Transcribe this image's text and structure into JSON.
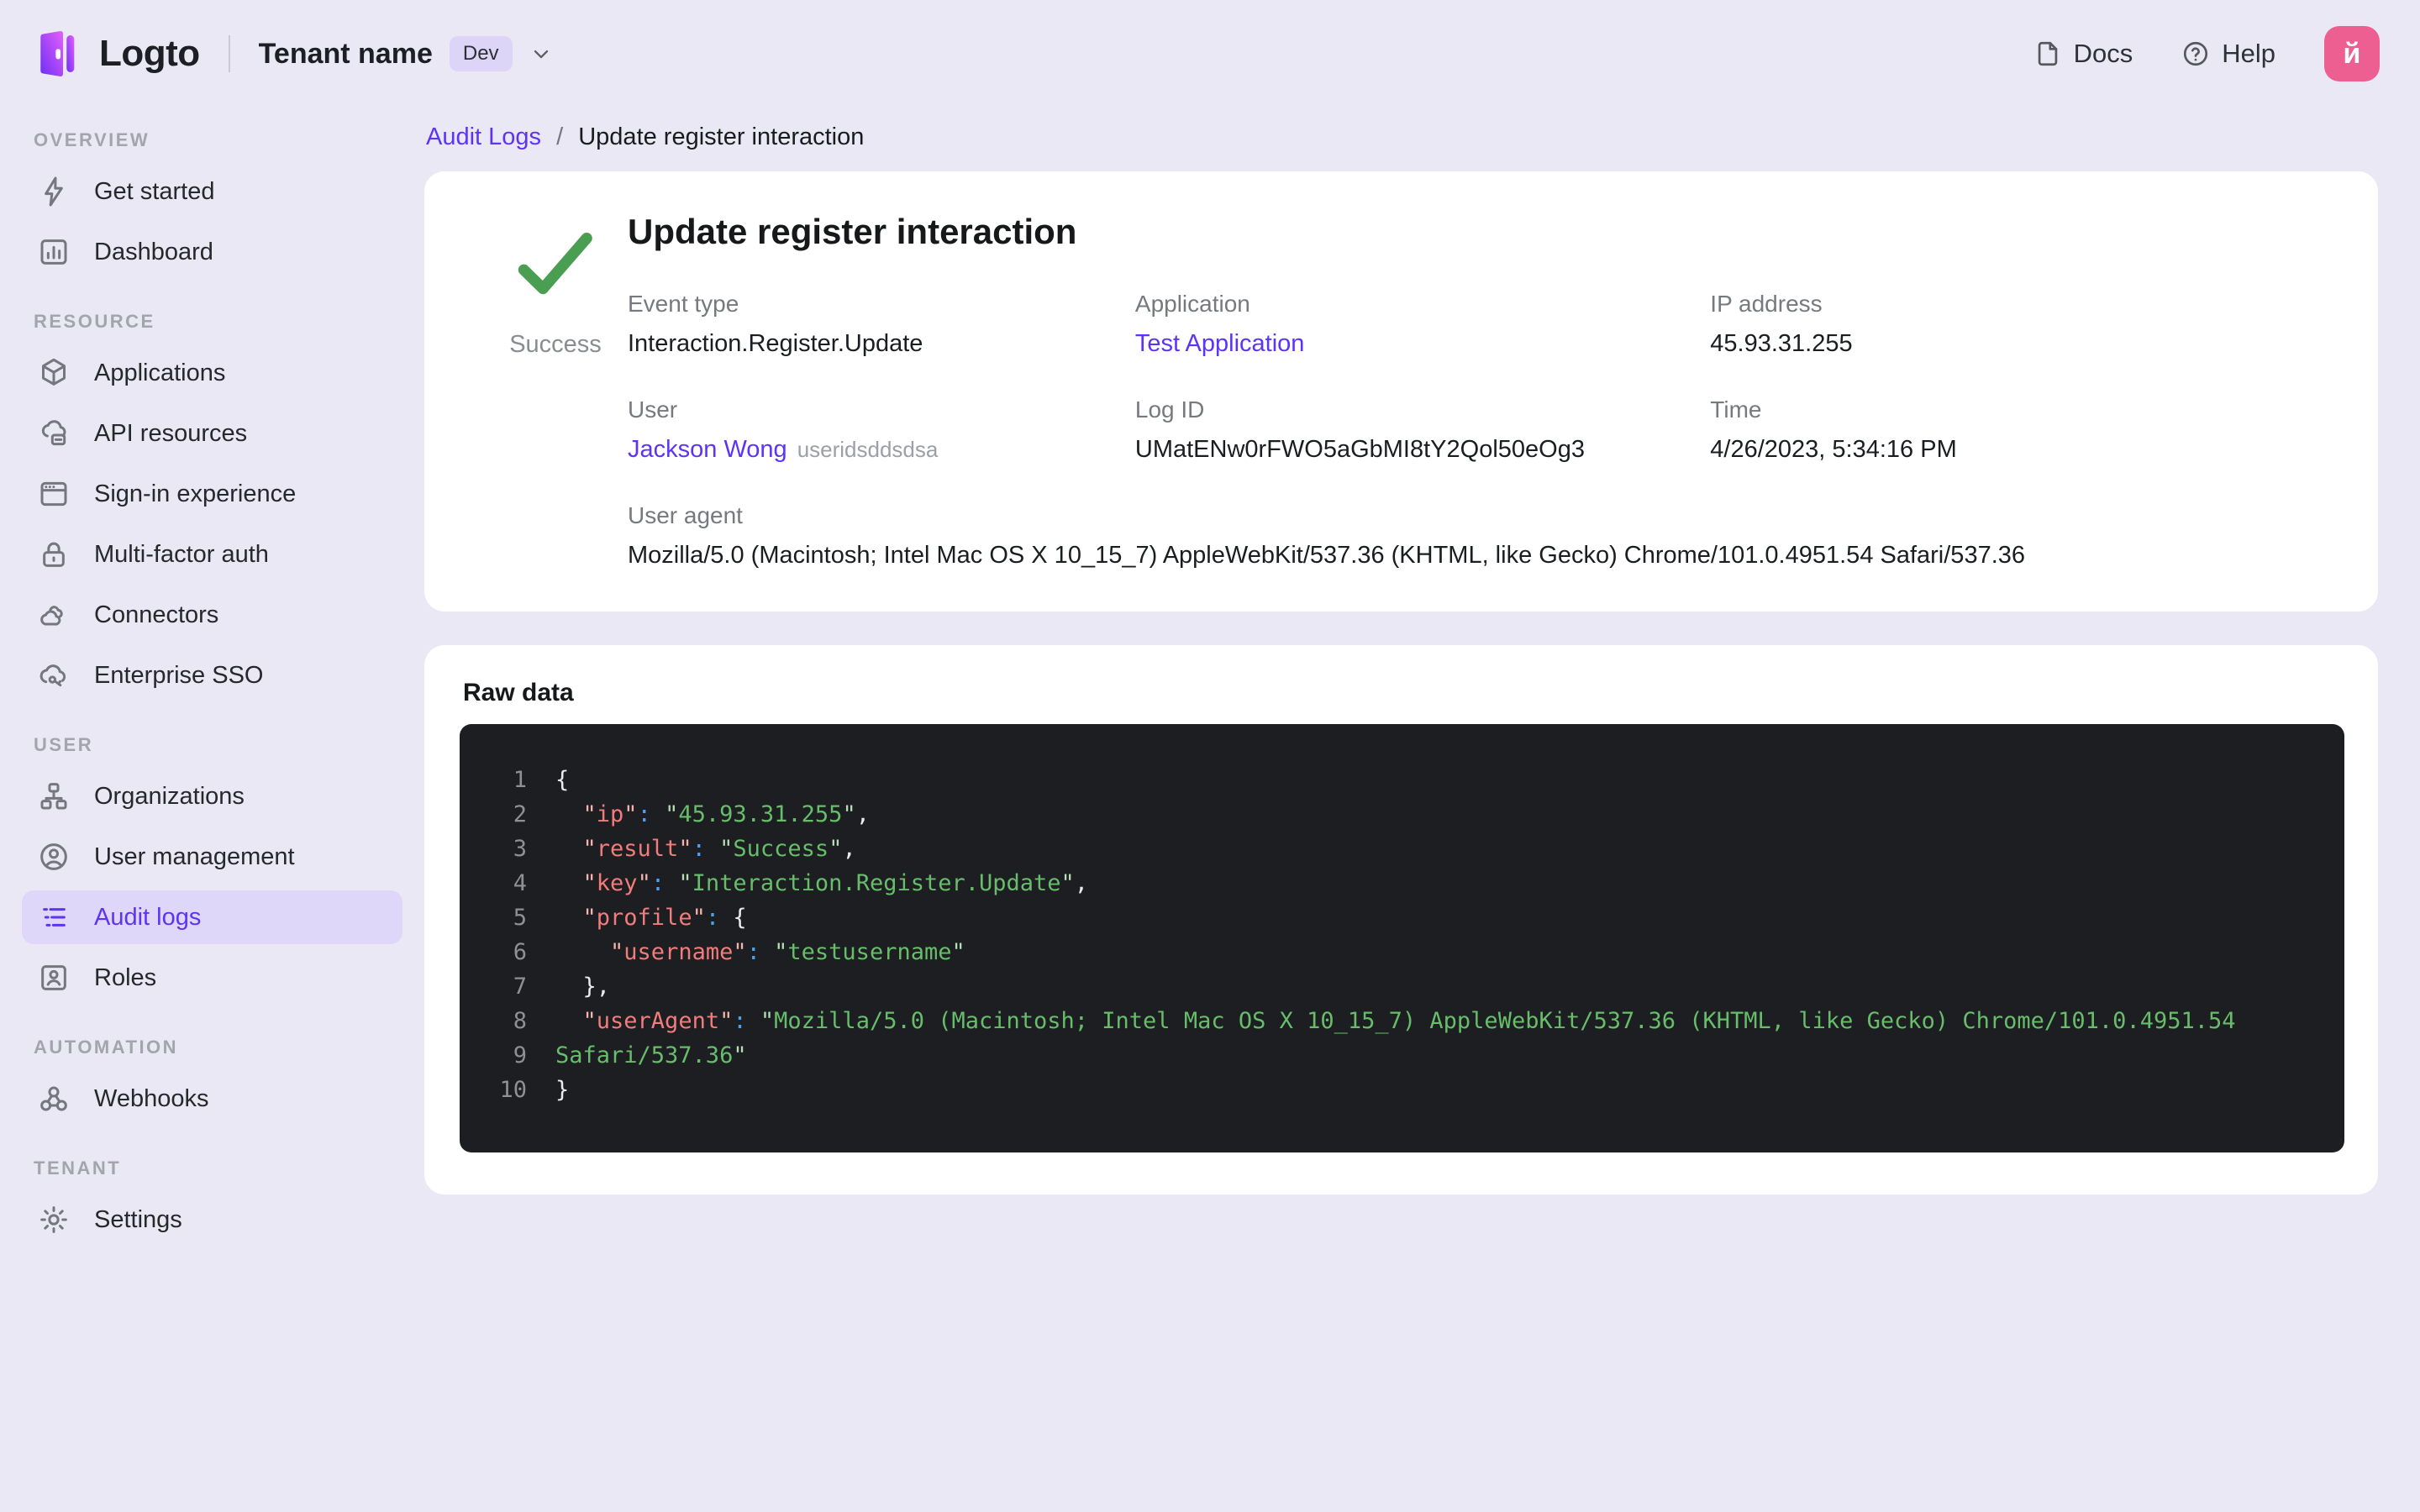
{
  "topbar": {
    "logo_text": "Logto",
    "tenant_name": "Tenant name",
    "tenant_tag": "Dev",
    "docs_label": "Docs",
    "help_label": "Help",
    "avatar_letter": "й"
  },
  "colors": {
    "accent": "#5d34f2",
    "selected_pill_bg": "#ded7f9",
    "page_bg": "#eae8f4",
    "success_green": "#4a9e52",
    "avatar_pink": "#ed5f90",
    "code_bg": "#1c1e21",
    "code_key": "#f27c7c",
    "code_string": "#67bd6a",
    "code_colon": "#4d9ff2"
  },
  "sidebar": {
    "sections": [
      {
        "label": "OVERVIEW",
        "items": [
          {
            "key": "get-started",
            "label": "Get started",
            "icon": "lightning-icon",
            "active": false
          },
          {
            "key": "dashboard",
            "label": "Dashboard",
            "icon": "dashboard-icon",
            "active": false
          }
        ]
      },
      {
        "label": "RESOURCE",
        "items": [
          {
            "key": "applications",
            "label": "Applications",
            "icon": "cube-icon",
            "active": false
          },
          {
            "key": "api-resources",
            "label": "API resources",
            "icon": "cloud-box-icon",
            "active": false
          },
          {
            "key": "sign-in-experience",
            "label": "Sign-in experience",
            "icon": "browser-icon",
            "active": false
          },
          {
            "key": "multi-factor-auth",
            "label": "Multi-factor auth",
            "icon": "lock-icon",
            "active": false
          },
          {
            "key": "connectors",
            "label": "Connectors",
            "icon": "clouds-icon",
            "active": false
          },
          {
            "key": "enterprise-sso",
            "label": "Enterprise SSO",
            "icon": "cloud-key-icon",
            "active": false
          }
        ]
      },
      {
        "label": "USER",
        "items": [
          {
            "key": "organizations",
            "label": "Organizations",
            "icon": "orgchart-icon",
            "active": false
          },
          {
            "key": "user-management",
            "label": "User management",
            "icon": "person-circle-icon",
            "active": false
          },
          {
            "key": "audit-logs",
            "label": "Audit logs",
            "icon": "list-icon",
            "active": true
          },
          {
            "key": "roles",
            "label": "Roles",
            "icon": "id-card-icon",
            "active": false
          }
        ]
      },
      {
        "label": "AUTOMATION",
        "items": [
          {
            "key": "webhooks",
            "label": "Webhooks",
            "icon": "webhook-icon",
            "active": false
          }
        ]
      },
      {
        "label": "TENANT",
        "items": [
          {
            "key": "settings",
            "label": "Settings",
            "icon": "gear-icon",
            "active": false
          }
        ]
      }
    ]
  },
  "breadcrumb": {
    "parent": "Audit Logs",
    "separator": "/",
    "current": "Update register interaction"
  },
  "detail": {
    "title": "Update register interaction",
    "status": "Success",
    "fields": [
      {
        "label": "Event type",
        "value": "Interaction.Register.Update",
        "type": "text"
      },
      {
        "label": "Application",
        "value": "Test Application",
        "type": "link"
      },
      {
        "label": "IP address",
        "value": "45.93.31.255",
        "type": "text"
      },
      {
        "label": "User",
        "value": "Jackson Wong",
        "suffix": "useridsddsdsa",
        "type": "link"
      },
      {
        "label": "Log ID",
        "value": "UMatENw0rFWO5aGbMI8tY2Qol50eOg3",
        "type": "text"
      },
      {
        "label": "Time",
        "value": "4/26/2023, 5:34:16 PM",
        "type": "text"
      }
    ],
    "user_agent_label": "User agent",
    "user_agent": "Mozilla/5.0 (Macintosh; Intel Mac OS X 10_15_7) AppleWebKit/537.36 (KHTML, like Gecko) Chrome/101.0.4951.54 Safari/537.36"
  },
  "raw": {
    "section_title": "Raw data",
    "lines": [
      {
        "n": "1",
        "seg": [
          [
            "punc",
            "{"
          ]
        ]
      },
      {
        "n": "2",
        "seg": [
          [
            "plain",
            "  "
          ],
          [
            "qk",
            "\""
          ],
          [
            "key",
            "ip"
          ],
          [
            "qk",
            "\""
          ],
          [
            "colon",
            ":"
          ],
          [
            "plain",
            " "
          ],
          [
            "qs",
            "\""
          ],
          [
            "str",
            "45.93.31.255"
          ],
          [
            "qs",
            "\""
          ],
          [
            "punc",
            ","
          ]
        ]
      },
      {
        "n": "3",
        "seg": [
          [
            "plain",
            "  "
          ],
          [
            "qk",
            "\""
          ],
          [
            "key",
            "result"
          ],
          [
            "qk",
            "\""
          ],
          [
            "colon",
            ":"
          ],
          [
            "plain",
            " "
          ],
          [
            "qs",
            "\""
          ],
          [
            "str",
            "Success"
          ],
          [
            "qs",
            "\""
          ],
          [
            "punc",
            ","
          ]
        ]
      },
      {
        "n": "4",
        "seg": [
          [
            "plain",
            "  "
          ],
          [
            "qk",
            "\""
          ],
          [
            "key",
            "key"
          ],
          [
            "qk",
            "\""
          ],
          [
            "colon",
            ":"
          ],
          [
            "plain",
            " "
          ],
          [
            "qs",
            "\""
          ],
          [
            "str",
            "Interaction.Register.Update"
          ],
          [
            "qs",
            "\""
          ],
          [
            "punc",
            ","
          ]
        ]
      },
      {
        "n": "5",
        "seg": [
          [
            "plain",
            "  "
          ],
          [
            "qk",
            "\""
          ],
          [
            "key",
            "profile"
          ],
          [
            "qk",
            "\""
          ],
          [
            "colon",
            ":"
          ],
          [
            "plain",
            " "
          ],
          [
            "punc",
            "{"
          ]
        ]
      },
      {
        "n": "6",
        "seg": [
          [
            "plain",
            "    "
          ],
          [
            "qk",
            "\""
          ],
          [
            "key",
            "username"
          ],
          [
            "qk",
            "\""
          ],
          [
            "colon",
            ":"
          ],
          [
            "plain",
            " "
          ],
          [
            "qs",
            "\""
          ],
          [
            "str",
            "testusername"
          ],
          [
            "qs",
            "\""
          ]
        ]
      },
      {
        "n": "7",
        "seg": [
          [
            "plain",
            "  "
          ],
          [
            "punc",
            "},"
          ]
        ]
      },
      {
        "n": "8",
        "seg": [
          [
            "plain",
            "  "
          ],
          [
            "qk",
            "\""
          ],
          [
            "key",
            "userAgent"
          ],
          [
            "qk",
            "\""
          ],
          [
            "colon",
            ":"
          ],
          [
            "plain",
            " "
          ],
          [
            "qs",
            "\""
          ],
          [
            "str",
            "Mozilla/5.0 (Macintosh; Intel Mac OS X 10_15_7) AppleWebKit/537.36 (KHTML, like Gecko) Chrome/101.0.4951.54"
          ]
        ]
      },
      {
        "n": "9",
        "seg": [
          [
            "str",
            "Safari/537.36"
          ],
          [
            "qs",
            "\""
          ]
        ]
      },
      {
        "n": "10",
        "seg": [
          [
            "punc",
            "}"
          ]
        ]
      }
    ]
  }
}
